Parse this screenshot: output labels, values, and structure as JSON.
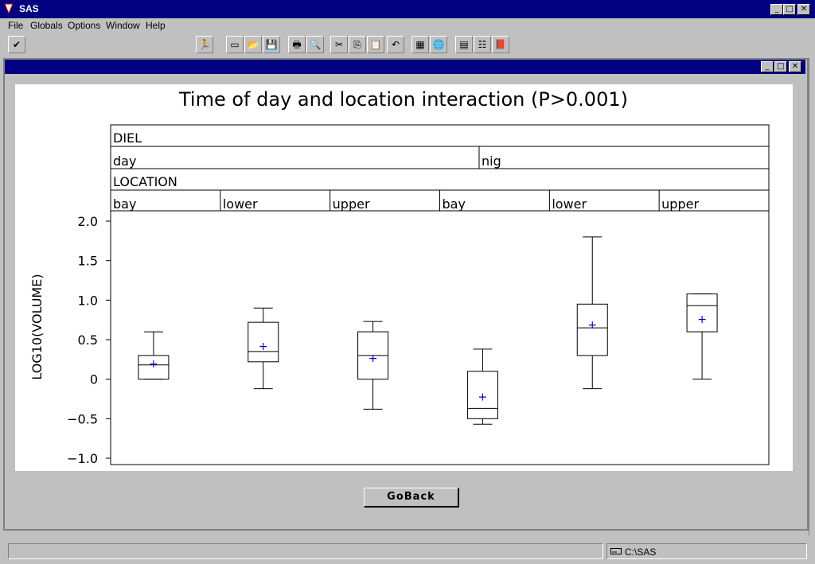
{
  "window": {
    "title": "SAS"
  },
  "menu": {
    "items": [
      "File",
      "Globals",
      "Options",
      "Window",
      "Help"
    ]
  },
  "toolbar": {
    "command_value": "",
    "icons": [
      "submit-icon",
      "run-icon",
      "new-icon",
      "open-icon",
      "save-icon",
      "print-icon",
      "print-preview-icon",
      "cut-icon",
      "copy-icon",
      "paste-icon",
      "undo-icon",
      "ms-dos-icon",
      "globe-icon",
      "explorer-icon",
      "table-icon",
      "help-book-icon"
    ]
  },
  "goback_label": "GoBack",
  "status": {
    "path": "C:\\SAS"
  },
  "chart_data": {
    "type": "boxplot",
    "title": "Time of day and location interaction (P>0.001)",
    "ylabel": "LOG10(VOLUME)",
    "ylim": [
      -1.0,
      2.0
    ],
    "yticks": [
      2.0,
      1.5,
      1.0,
      0.5,
      0,
      -0.5,
      -1.0
    ],
    "ytick_labels": [
      "2.0",
      "1.5",
      "1.0",
      "0.5",
      "0",
      "−0.5",
      "−1.0"
    ],
    "header": {
      "factor1_label": "DIEL",
      "factor1_levels": [
        "day",
        "nig"
      ],
      "factor2_label": "LOCATION",
      "factor2_levels": [
        "bay",
        "lower",
        "upper",
        "bay",
        "lower",
        "upper"
      ]
    },
    "series": [
      {
        "group": "day",
        "location": "bay",
        "min": 0.0,
        "q1": 0.0,
        "median": 0.18,
        "q3": 0.3,
        "max": 0.6,
        "mean": 0.2
      },
      {
        "group": "day",
        "location": "lower",
        "min": -0.12,
        "q1": 0.22,
        "median": 0.35,
        "q3": 0.72,
        "max": 0.9,
        "mean": 0.42
      },
      {
        "group": "day",
        "location": "upper",
        "min": -0.38,
        "q1": 0.0,
        "median": 0.3,
        "q3": 0.6,
        "max": 0.73,
        "mean": 0.27
      },
      {
        "group": "nig",
        "location": "bay",
        "min": -0.57,
        "q1": -0.5,
        "median": -0.37,
        "q3": 0.1,
        "max": 0.38,
        "mean": -0.22
      },
      {
        "group": "nig",
        "location": "lower",
        "min": -0.12,
        "q1": 0.3,
        "median": 0.65,
        "q3": 0.95,
        "max": 1.8,
        "mean": 0.69
      },
      {
        "group": "nig",
        "location": "upper",
        "min": 0.0,
        "q1": 0.6,
        "median": 0.93,
        "q3": 1.08,
        "max": 1.08,
        "mean": 0.76
      }
    ]
  }
}
